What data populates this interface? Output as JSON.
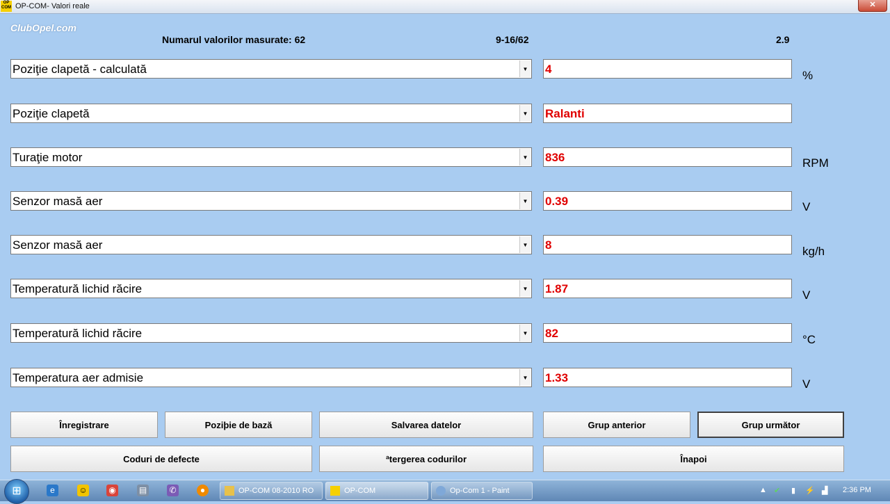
{
  "window": {
    "title": "OP-COM- Valori reale",
    "icon_text": "OP COM",
    "close_glyph": "✕"
  },
  "logo": "ClubOpel.com",
  "header": {
    "count_label": "Numarul valorilor masurate: 62",
    "range": "9-16/62",
    "version": "2.9"
  },
  "rows": [
    {
      "label": "Poziţie clapetă - calculată",
      "value": "4",
      "unit": "%"
    },
    {
      "label": "Poziţie clapetă",
      "value": "Ralanti",
      "unit": ""
    },
    {
      "label": "Turaţie motor",
      "value": "836",
      "unit": "RPM"
    },
    {
      "label": "Senzor masă aer",
      "value": "0.39",
      "unit": "V"
    },
    {
      "label": "Senzor masă aer",
      "value": "8",
      "unit": "kg/h"
    },
    {
      "label": "Temperatură lichid răcire",
      "value": "1.87",
      "unit": "V"
    },
    {
      "label": "Temperatură lichid răcire",
      "value": "82",
      "unit": "°C"
    },
    {
      "label": "Temperatura aer admisie",
      "value": "1.33",
      "unit": "V"
    }
  ],
  "buttons": {
    "record": "Înregistrare",
    "base_position": "Poziþie de bază",
    "save_data": "Salvarea datelor",
    "prev_group": "Grup anterior",
    "next_group": "Grup următor",
    "fault_codes": "Coduri de defecte",
    "clear_codes": "ªtergerea codurilor",
    "back": "Înapoi"
  },
  "taskbar": {
    "tasks": [
      "OP-COM 08-2010 RO",
      "OP-COM",
      "Op-Com 1 - Paint"
    ],
    "clock": "2:36 PM"
  },
  "colors": {
    "background": "#a9ccf1",
    "value_text": "#e00000"
  }
}
